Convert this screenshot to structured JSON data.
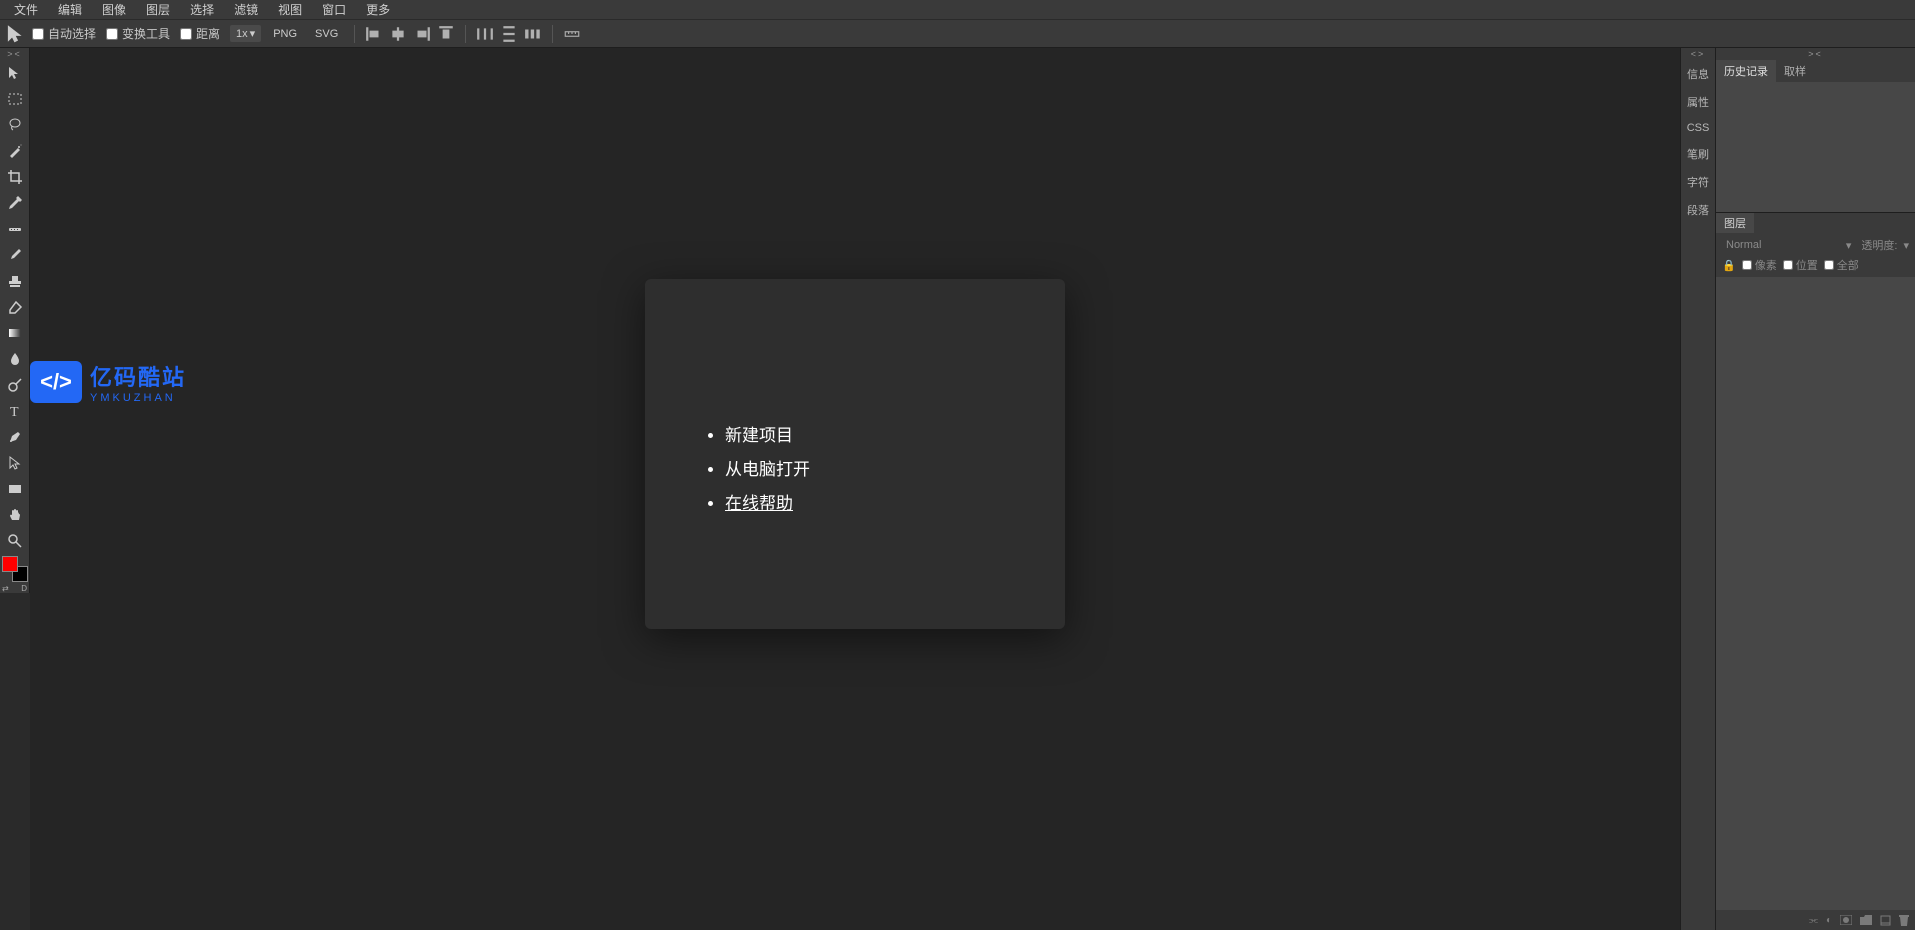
{
  "menubar": {
    "file": "文件",
    "edit": "编辑",
    "image": "图像",
    "layer": "图层",
    "select": "选择",
    "filter": "滤镜",
    "view": "视图",
    "window": "窗口",
    "more": "更多"
  },
  "optionsbar": {
    "auto_select": "自动选择",
    "transform_tool": "变换工具",
    "distance": "距离",
    "scale": "1x",
    "png": "PNG",
    "svg": "SVG"
  },
  "welcome": {
    "new_project": "新建项目",
    "open_from_computer": "从电脑打开",
    "online_help": "在线帮助"
  },
  "watermark": {
    "cn": "亿码酷站",
    "en": "YMKUZHAN"
  },
  "side_tabs": {
    "info": "信息",
    "properties": "属性",
    "css": "CSS",
    "brush": "笔刷",
    "character": "字符",
    "paragraph": "段落"
  },
  "panels": {
    "history": "历史记录",
    "swatches": "取样",
    "layers": "图层"
  },
  "layer_controls": {
    "blend_mode": "Normal",
    "opacity_label": "透明度:",
    "lock_pixels": "像素",
    "lock_position": "位置",
    "lock_all": "全部"
  },
  "footer_icons": {
    "link": "GO",
    "effects": "off"
  }
}
